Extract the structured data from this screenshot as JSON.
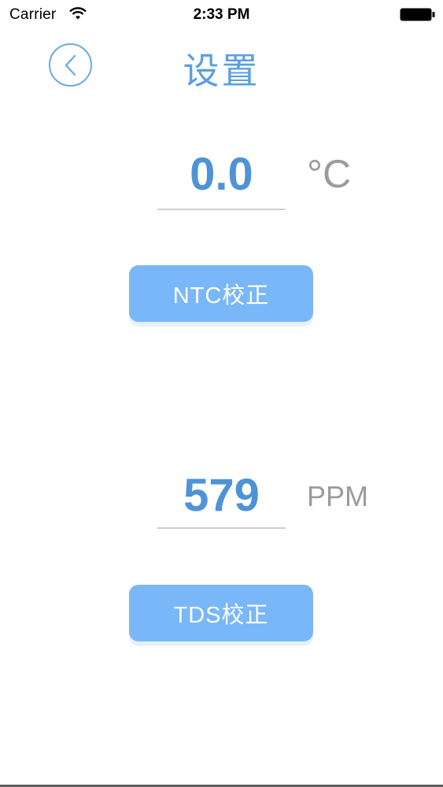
{
  "status_bar": {
    "carrier": "Carrier",
    "time": "2:33 PM",
    "wifi_icon": "wifi-icon",
    "battery_icon": "battery-icon"
  },
  "header": {
    "title": "设置",
    "back_icon": "chevron-left-icon"
  },
  "temperature": {
    "value": "0.0",
    "unit": "°C",
    "button_label": "NTC校正"
  },
  "tds": {
    "value": "579",
    "unit": "PPM",
    "button_label": "TDS校正"
  },
  "colors": {
    "accent": "#5b9fe0",
    "value_text": "#4e93d8",
    "button_bg": "#79b7f8",
    "unit_text": "#9b9b9b"
  }
}
